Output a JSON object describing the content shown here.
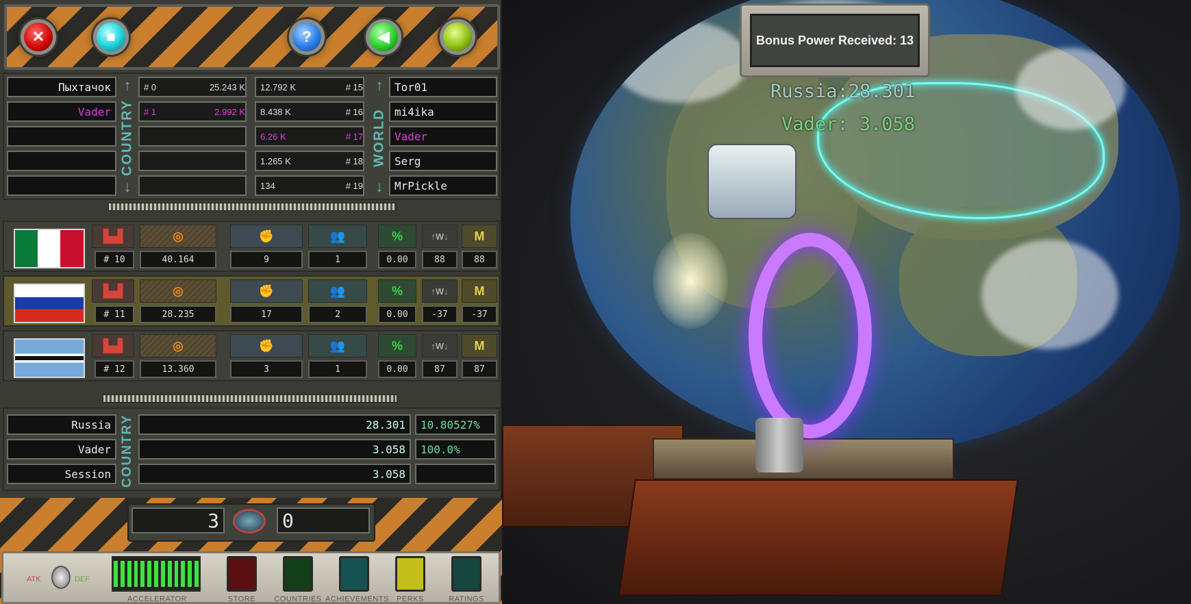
{
  "top_buttons": [
    {
      "name": "red-x-button",
      "color": "#d11a1a",
      "glyph": "✕"
    },
    {
      "name": "cyan-square-button",
      "color": "#18d1d8",
      "glyph": "■"
    },
    {
      "name": "help-button",
      "color": "#2a7de8",
      "glyph": "?"
    },
    {
      "name": "green-sound-button",
      "color": "#2ad12a",
      "glyph": "◀"
    },
    {
      "name": "olive-button",
      "color": "#8fbf12",
      "glyph": ""
    }
  ],
  "leaderboard": {
    "country_label": "COUNTRY",
    "world_label": "WORLD",
    "country_rows": [
      {
        "name": "Пыхтачок",
        "rank": "# 0",
        "score": "25.243 K",
        "highlight": false
      },
      {
        "name": "Vader",
        "rank": "# 1",
        "score": "2.992 K",
        "highlight": true
      },
      {
        "name": "",
        "rank": "",
        "score": "",
        "highlight": false
      },
      {
        "name": "",
        "rank": "",
        "score": "",
        "highlight": false
      },
      {
        "name": "",
        "rank": "",
        "score": "",
        "highlight": false
      }
    ],
    "world_rows": [
      {
        "score": "12.792 K",
        "rank": "# 15",
        "name": "Tor01",
        "highlight": false
      },
      {
        "score": "8.438 K",
        "rank": "# 16",
        "name": "mi4ika",
        "highlight": false
      },
      {
        "score": "6.26 K",
        "rank": "# 17",
        "name": "Vader",
        "highlight": true
      },
      {
        "score": "1.265 K",
        "rank": "# 18",
        "name": "Serg",
        "highlight": false
      },
      {
        "score": "134",
        "rank": "# 19",
        "name": "MrPickle",
        "highlight": false
      }
    ]
  },
  "countries": [
    {
      "flag": "mexico",
      "rank": "# 10",
      "power": "40.164",
      "v1": "9",
      "v2": "1",
      "pct": "0.00",
      "w": "88",
      "m": "88",
      "highlight": false
    },
    {
      "flag": "russia",
      "rank": "# 11",
      "power": "28.235",
      "v1": "17",
      "v2": "2",
      "pct": "0.00",
      "w": "-37",
      "m": "-37",
      "highlight": true
    },
    {
      "flag": "botswana",
      "rank": "# 12",
      "power": "13.360",
      "v1": "3",
      "v2": "1",
      "pct": "0.00",
      "w": "87",
      "m": "87",
      "highlight": false
    }
  ],
  "icons": {
    "w_label": "↑W↓",
    "m_label": "M",
    "pct_label": "%"
  },
  "stats": {
    "label": "COUNTRY",
    "rows": [
      {
        "name": "Russia",
        "value": "28.301",
        "pct": "10.80527%"
      },
      {
        "name": "Vader",
        "value": "3.058",
        "pct": "100.0%"
      },
      {
        "name": "Session",
        "value": "3.058",
        "pct": ""
      }
    ]
  },
  "counters": {
    "left": "3",
    "right": "0"
  },
  "menu": {
    "atk": "ATK",
    "def": "DEF",
    "items": [
      {
        "label": "ACCELERATOR",
        "color": "#2fe02f"
      },
      {
        "label": "STORE",
        "color": "#6a1414"
      },
      {
        "label": "COUNTRIES",
        "color": "#14481a"
      },
      {
        "label": "ACHIEVEMENTS",
        "color": "#1a5a5a"
      },
      {
        "label": "PERKS",
        "color": "#c8c21a"
      },
      {
        "label": "RATINGS",
        "color": "#1a4a44"
      }
    ]
  },
  "scene": {
    "bonus": "Bonus Power Received: 13",
    "country_overlay": "Russia:28.301",
    "player_overlay": "Vader: 3.058"
  }
}
